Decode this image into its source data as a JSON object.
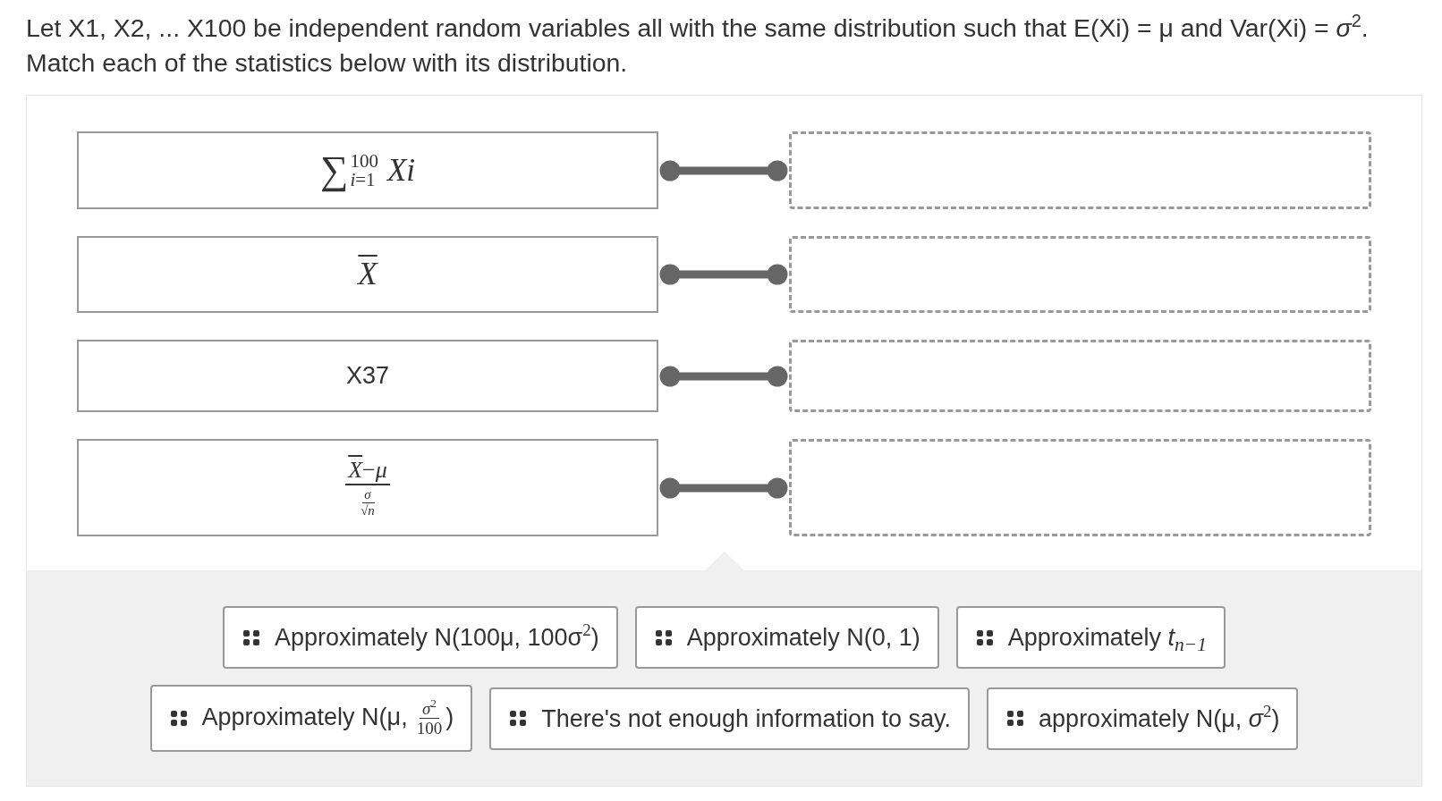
{
  "question": "Let X1, X2, ... X100 be independent random variables all with the same distribution such that E(Xi) = μ and Var(Xi) = *σ*$^{2}$.",
  "instruction": "Match each of the statistics below with its distribution.",
  "statistics": [
    {
      "kind": "sum",
      "operator": "∑",
      "upper": "100",
      "lower": "*i*=1",
      "term": "Xi"
    },
    {
      "kind": "bar",
      "symbol": "X"
    },
    {
      "kind": "text",
      "text": "X37"
    },
    {
      "kind": "ratio",
      "bar_symbol": "X",
      "rest": "−*μ*",
      "inner_top": "σ",
      "radical": "√",
      "radicand": "n"
    }
  ],
  "choices": [
    {
      "kind": "text",
      "text": "Approximately N(100μ, 100σ$^{2}$)"
    },
    {
      "kind": "text",
      "text": "Approximately N(0, 1)"
    },
    {
      "kind": "text",
      "text": "Approximately *t*$_{n−1}$"
    },
    {
      "kind": "fraction",
      "prefix": "Approximately N(μ,",
      "numerator": "*σ*$^{2}$",
      "denominator": "100",
      "suffix": ")"
    },
    {
      "kind": "text",
      "text": "There's not enough information to say."
    },
    {
      "kind": "text",
      "text": "approximately N(μ, *σ*$^{2}$)"
    }
  ]
}
